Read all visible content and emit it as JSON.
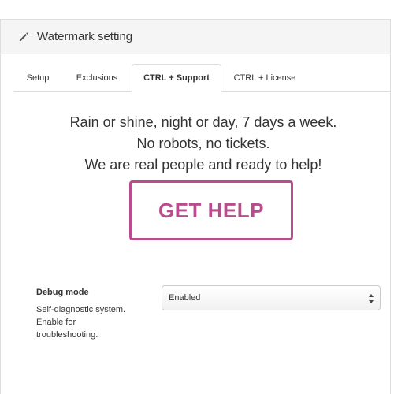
{
  "panel": {
    "title": "Watermark setting",
    "icon": "pencil-icon"
  },
  "tabs": [
    {
      "label": "Setup",
      "active": false
    },
    {
      "label": "Exclusions",
      "active": false
    },
    {
      "label": "CTRL + Support",
      "active": true
    },
    {
      "label": "CTRL + License",
      "active": false
    }
  ],
  "support": {
    "lines": [
      "Rain or shine, night or day, 7 days a week.",
      "No robots, no tickets.",
      "We are real people and ready to help!"
    ],
    "button_label": "GET HELP",
    "accent_color": "#b94c8c"
  },
  "debug": {
    "label": "Debug mode",
    "description_lines": [
      "Self-diagnostic system.",
      "Enable for",
      "troubleshooting."
    ],
    "selected_value": "Enabled"
  }
}
